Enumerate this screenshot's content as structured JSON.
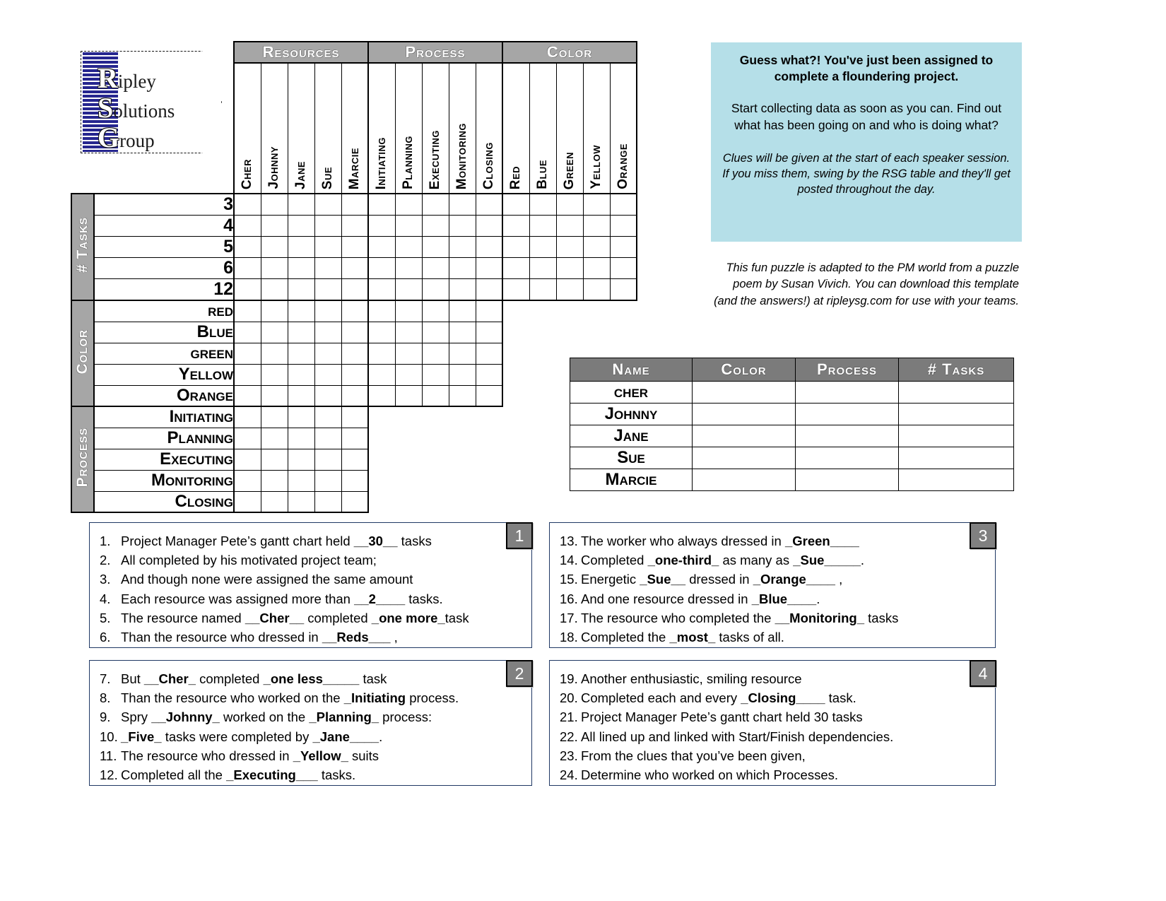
{
  "logo": {
    "line1_cap": "R",
    "line1_rest": "ipley",
    "line2_cap": "S",
    "line2_rest": "olutions",
    "line3_cap": "G",
    "line3_rest": "roup"
  },
  "grid": {
    "category_headers": [
      "Resources",
      "Process",
      "Color"
    ],
    "columns": {
      "resources": [
        "Cher",
        "Johnny",
        "Jane",
        "Sue",
        "Marcie"
      ],
      "process": [
        "Initiating",
        "Planning",
        "Executing",
        "Monitoring",
        "Closing"
      ],
      "color": [
        "Red",
        "Blue",
        "Green",
        "Yellow",
        "Orange"
      ]
    },
    "row_groups": [
      {
        "label": "# Tasks",
        "rows": [
          "3",
          "4",
          "5",
          "6",
          "12"
        ]
      },
      {
        "label": "Color",
        "rows": [
          "red",
          "Blue",
          "green",
          "Yellow",
          "Orange"
        ]
      },
      {
        "label": "Process",
        "rows": [
          "Initiating",
          "Planning",
          "Executing",
          "Monitoring",
          "Closing"
        ]
      }
    ]
  },
  "callout": {
    "headline": "Guess what?! You've just been assigned to complete a floundering project.",
    "body": "Start collecting data as soon as you can.  Find out what has been going on and who is doing what?",
    "note": "Clues will be given at the start of each speaker session.  If you miss them, swing by the RSG table and they'll get posted throughout the day.",
    "bg_color": "#b5dfe8"
  },
  "credit": "This fun puzzle is adapted to the PM world from a puzzle poem by Susan Vivich.  You can download this template (and the answers!) at ripleysg.com for use with your teams.",
  "answer_table": {
    "headers": [
      "Name",
      "Color",
      "Process",
      "# Tasks"
    ],
    "rows": [
      {
        "name": "cher",
        "color": "",
        "process": "",
        "tasks": ""
      },
      {
        "name": "Johnny",
        "color": "",
        "process": "",
        "tasks": ""
      },
      {
        "name": "Jane",
        "color": "",
        "process": "",
        "tasks": ""
      },
      {
        "name": "Sue",
        "color": "",
        "process": "",
        "tasks": ""
      },
      {
        "name": "Marcie",
        "color": "",
        "process": "",
        "tasks": ""
      }
    ]
  },
  "clue_boxes": [
    {
      "badge": "1",
      "clues": [
        {
          "n": "1.",
          "html": "Project Manager Pete’s gantt chart held <b>__30__</b> tasks"
        },
        {
          "n": "2.",
          "html": "All completed by his motivated project team;"
        },
        {
          "n": "3.",
          "html": "And though none were assigned the same amount"
        },
        {
          "n": "4.",
          "html": "Each resource was assigned more than <b>__2____</b> tasks."
        },
        {
          "n": "5.",
          "html": "The resource named <b>__Cher__</b> completed <b>_one more_</b>task"
        },
        {
          "n": "6.",
          "html": "Than the resource who dressed in <b>__Reds___</b> ,"
        }
      ]
    },
    {
      "badge": "2",
      "clues": [
        {
          "n": "7.",
          "html": "But <b>__Cher_</b> completed <b>_one less_____</b> task"
        },
        {
          "n": "8.",
          "html": "Than the resource who worked on the <b>_Initiating</b> process."
        },
        {
          "n": "9.",
          "html": "Spry <b>__Johnny_</b> worked on the <b>_Planning_</b> process:"
        },
        {
          "n": "10.",
          "html": "<b>_Five_</b> tasks were completed by <b>_Jane____</b>."
        },
        {
          "n": "11.",
          "html": "The resource who dressed in <b>_Yellow_</b> suits"
        },
        {
          "n": "12.",
          "html": "Completed all the <b>_Executing___</b> tasks."
        }
      ]
    },
    {
      "badge": "3",
      "clues": [
        {
          "n": "13.",
          "html": "The worker who always dressed in <b>_Green____</b>"
        },
        {
          "n": "14.",
          "html": "Completed <b>_one-third_</b> as many as <b>_Sue_____</b>."
        },
        {
          "n": "15.",
          "html": "Energetic <b>_Sue__</b> dressed in <b>_Orange____</b> ,"
        },
        {
          "n": "16.",
          "html": "And one resource dressed in <b>_Blue____</b>."
        },
        {
          "n": "17.",
          "html": "The resource who completed the <b>__Monitoring_</b> tasks"
        },
        {
          "n": "18.",
          "html": "Completed the <b>_most_</b> tasks of all."
        }
      ]
    },
    {
      "badge": "4",
      "clues": [
        {
          "n": "19.",
          "html": "Another enthusiastic, smiling resource"
        },
        {
          "n": "20.",
          "html": "Completed each and every <b>_Closing____</b> task."
        },
        {
          "n": "21.",
          "html": "Project Manager Pete’s gantt chart held 30 tasks"
        },
        {
          "n": "22.",
          "html": "All lined up and linked with Start/Finish dependencies."
        },
        {
          "n": "23.",
          "html": "From the clues that you’ve been given,"
        },
        {
          "n": "24.",
          "html": "Determine who worked on which Processes."
        }
      ]
    }
  ]
}
